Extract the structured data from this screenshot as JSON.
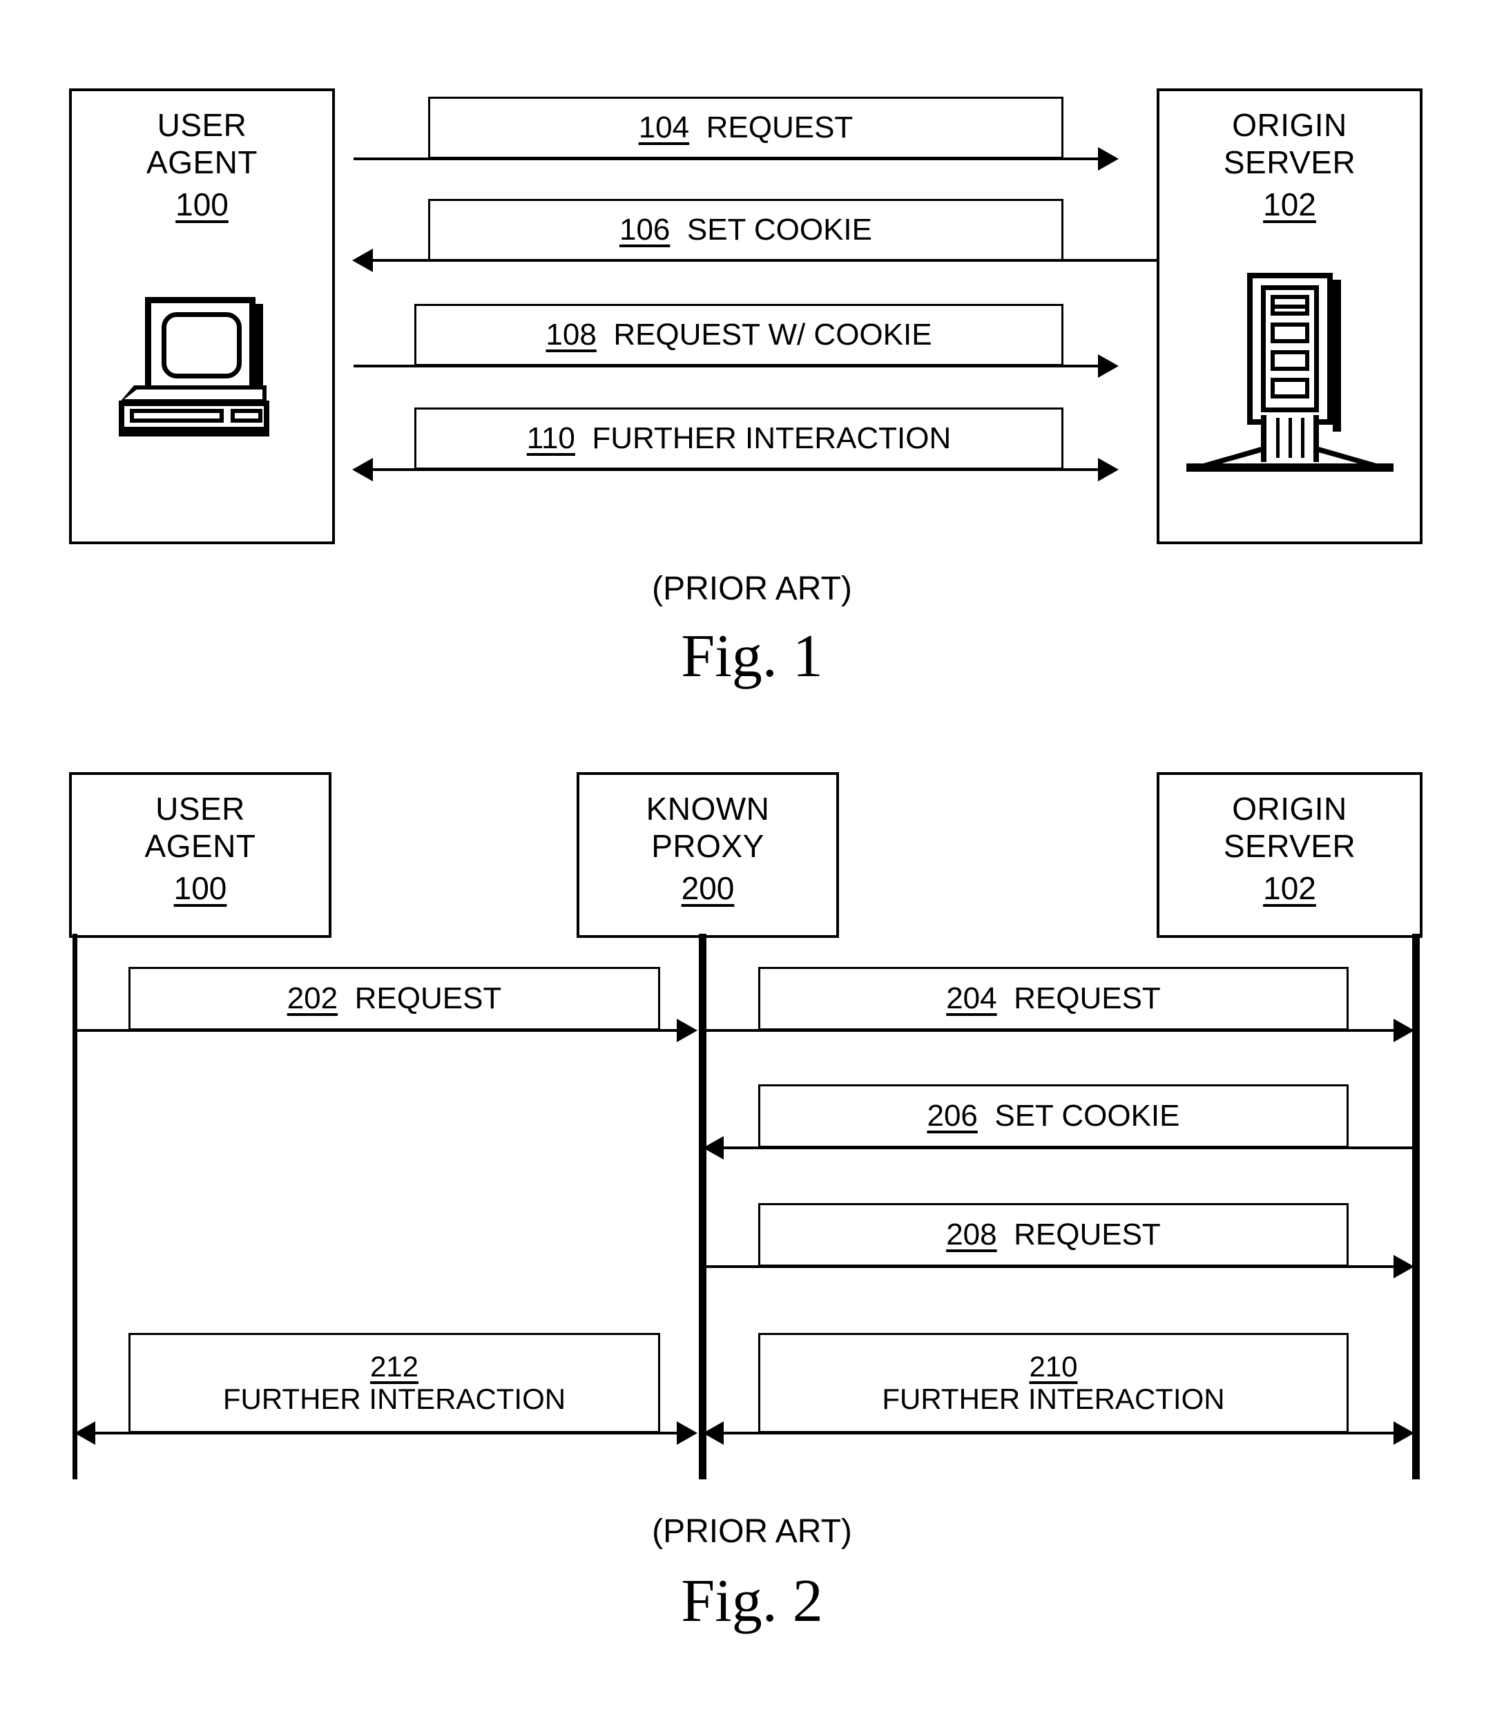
{
  "figure1": {
    "caption_prior_art": "(PRIOR ART)",
    "caption_fig": "Fig. 1",
    "nodes": [
      {
        "id": "user-agent",
        "line1": "USER",
        "line2": "AGENT",
        "ref": "100",
        "icon": "computer-icon"
      },
      {
        "id": "origin-server",
        "line1": "ORIGIN",
        "line2": "SERVER",
        "ref": "102",
        "icon": "server-icon"
      }
    ],
    "messages": [
      {
        "ref": "104",
        "label": "REQUEST",
        "direction": "right"
      },
      {
        "ref": "106",
        "label": "SET COOKIE",
        "direction": "left"
      },
      {
        "ref": "108",
        "label": "REQUEST W/ COOKIE",
        "direction": "right"
      },
      {
        "ref": "110",
        "label": "FURTHER INTERACTION",
        "direction": "both"
      }
    ]
  },
  "figure2": {
    "caption_prior_art": "(PRIOR ART)",
    "caption_fig": "Fig. 2",
    "nodes": [
      {
        "id": "user-agent",
        "line1": "USER",
        "line2": "AGENT",
        "ref": "100"
      },
      {
        "id": "known-proxy",
        "line1": "KNOWN",
        "line2": "PROXY",
        "ref": "200"
      },
      {
        "id": "origin-server",
        "line1": "ORIGIN",
        "line2": "SERVER",
        "ref": "102"
      }
    ],
    "messages_left": [
      {
        "ref": "202",
        "label": "REQUEST",
        "direction": "right"
      },
      {
        "ref": "212",
        "label": "FURTHER INTERACTION",
        "direction": "both",
        "two_line": true
      }
    ],
    "messages_right": [
      {
        "ref": "204",
        "label": "REQUEST",
        "direction": "right"
      },
      {
        "ref": "206",
        "label": "SET COOKIE",
        "direction": "left"
      },
      {
        "ref": "208",
        "label": "REQUEST",
        "direction": "right"
      },
      {
        "ref": "210",
        "label": "FURTHER INTERACTION",
        "direction": "both",
        "two_line": true
      }
    ]
  },
  "colors": {
    "ink": "#000000",
    "paper": "#ffffff"
  }
}
